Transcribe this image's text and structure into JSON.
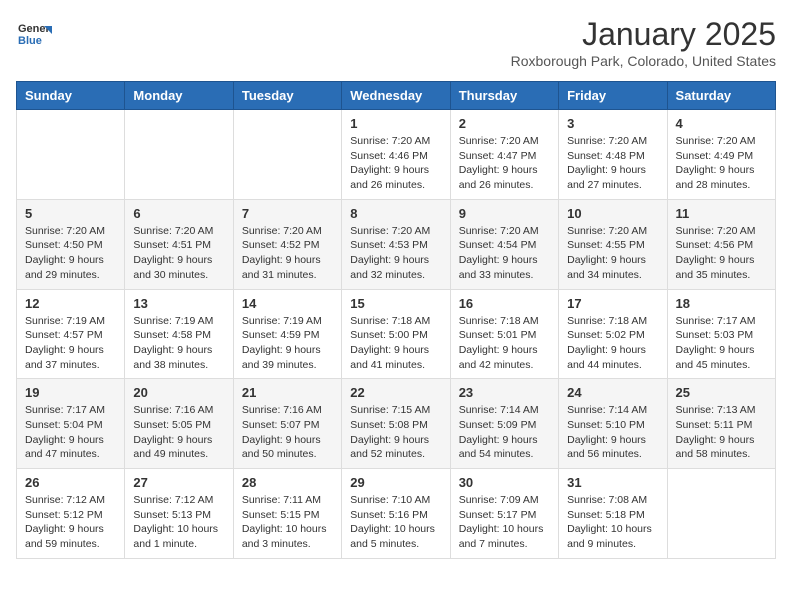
{
  "logo": {
    "line1": "General",
    "line2": "Blue"
  },
  "title": "January 2025",
  "location": "Roxborough Park, Colorado, United States",
  "weekdays": [
    "Sunday",
    "Monday",
    "Tuesday",
    "Wednesday",
    "Thursday",
    "Friday",
    "Saturday"
  ],
  "weeks": [
    [
      {
        "day": "",
        "info": ""
      },
      {
        "day": "",
        "info": ""
      },
      {
        "day": "",
        "info": ""
      },
      {
        "day": "1",
        "info": "Sunrise: 7:20 AM\nSunset: 4:46 PM\nDaylight: 9 hours\nand 26 minutes."
      },
      {
        "day": "2",
        "info": "Sunrise: 7:20 AM\nSunset: 4:47 PM\nDaylight: 9 hours\nand 26 minutes."
      },
      {
        "day": "3",
        "info": "Sunrise: 7:20 AM\nSunset: 4:48 PM\nDaylight: 9 hours\nand 27 minutes."
      },
      {
        "day": "4",
        "info": "Sunrise: 7:20 AM\nSunset: 4:49 PM\nDaylight: 9 hours\nand 28 minutes."
      }
    ],
    [
      {
        "day": "5",
        "info": "Sunrise: 7:20 AM\nSunset: 4:50 PM\nDaylight: 9 hours\nand 29 minutes."
      },
      {
        "day": "6",
        "info": "Sunrise: 7:20 AM\nSunset: 4:51 PM\nDaylight: 9 hours\nand 30 minutes."
      },
      {
        "day": "7",
        "info": "Sunrise: 7:20 AM\nSunset: 4:52 PM\nDaylight: 9 hours\nand 31 minutes."
      },
      {
        "day": "8",
        "info": "Sunrise: 7:20 AM\nSunset: 4:53 PM\nDaylight: 9 hours\nand 32 minutes."
      },
      {
        "day": "9",
        "info": "Sunrise: 7:20 AM\nSunset: 4:54 PM\nDaylight: 9 hours\nand 33 minutes."
      },
      {
        "day": "10",
        "info": "Sunrise: 7:20 AM\nSunset: 4:55 PM\nDaylight: 9 hours\nand 34 minutes."
      },
      {
        "day": "11",
        "info": "Sunrise: 7:20 AM\nSunset: 4:56 PM\nDaylight: 9 hours\nand 35 minutes."
      }
    ],
    [
      {
        "day": "12",
        "info": "Sunrise: 7:19 AM\nSunset: 4:57 PM\nDaylight: 9 hours\nand 37 minutes."
      },
      {
        "day": "13",
        "info": "Sunrise: 7:19 AM\nSunset: 4:58 PM\nDaylight: 9 hours\nand 38 minutes."
      },
      {
        "day": "14",
        "info": "Sunrise: 7:19 AM\nSunset: 4:59 PM\nDaylight: 9 hours\nand 39 minutes."
      },
      {
        "day": "15",
        "info": "Sunrise: 7:18 AM\nSunset: 5:00 PM\nDaylight: 9 hours\nand 41 minutes."
      },
      {
        "day": "16",
        "info": "Sunrise: 7:18 AM\nSunset: 5:01 PM\nDaylight: 9 hours\nand 42 minutes."
      },
      {
        "day": "17",
        "info": "Sunrise: 7:18 AM\nSunset: 5:02 PM\nDaylight: 9 hours\nand 44 minutes."
      },
      {
        "day": "18",
        "info": "Sunrise: 7:17 AM\nSunset: 5:03 PM\nDaylight: 9 hours\nand 45 minutes."
      }
    ],
    [
      {
        "day": "19",
        "info": "Sunrise: 7:17 AM\nSunset: 5:04 PM\nDaylight: 9 hours\nand 47 minutes."
      },
      {
        "day": "20",
        "info": "Sunrise: 7:16 AM\nSunset: 5:05 PM\nDaylight: 9 hours\nand 49 minutes."
      },
      {
        "day": "21",
        "info": "Sunrise: 7:16 AM\nSunset: 5:07 PM\nDaylight: 9 hours\nand 50 minutes."
      },
      {
        "day": "22",
        "info": "Sunrise: 7:15 AM\nSunset: 5:08 PM\nDaylight: 9 hours\nand 52 minutes."
      },
      {
        "day": "23",
        "info": "Sunrise: 7:14 AM\nSunset: 5:09 PM\nDaylight: 9 hours\nand 54 minutes."
      },
      {
        "day": "24",
        "info": "Sunrise: 7:14 AM\nSunset: 5:10 PM\nDaylight: 9 hours\nand 56 minutes."
      },
      {
        "day": "25",
        "info": "Sunrise: 7:13 AM\nSunset: 5:11 PM\nDaylight: 9 hours\nand 58 minutes."
      }
    ],
    [
      {
        "day": "26",
        "info": "Sunrise: 7:12 AM\nSunset: 5:12 PM\nDaylight: 9 hours\nand 59 minutes."
      },
      {
        "day": "27",
        "info": "Sunrise: 7:12 AM\nSunset: 5:13 PM\nDaylight: 10 hours\nand 1 minute."
      },
      {
        "day": "28",
        "info": "Sunrise: 7:11 AM\nSunset: 5:15 PM\nDaylight: 10 hours\nand 3 minutes."
      },
      {
        "day": "29",
        "info": "Sunrise: 7:10 AM\nSunset: 5:16 PM\nDaylight: 10 hours\nand 5 minutes."
      },
      {
        "day": "30",
        "info": "Sunrise: 7:09 AM\nSunset: 5:17 PM\nDaylight: 10 hours\nand 7 minutes."
      },
      {
        "day": "31",
        "info": "Sunrise: 7:08 AM\nSunset: 5:18 PM\nDaylight: 10 hours\nand 9 minutes."
      },
      {
        "day": "",
        "info": ""
      }
    ]
  ]
}
